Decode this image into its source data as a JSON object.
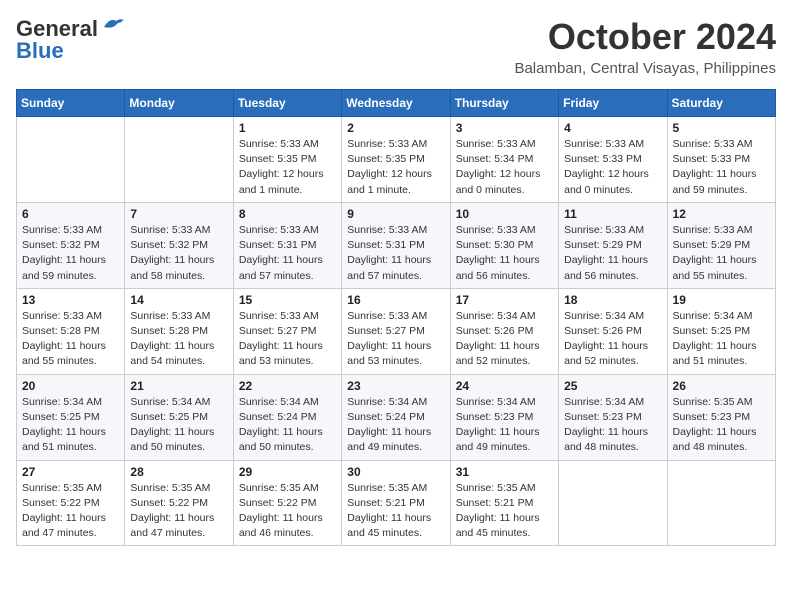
{
  "logo": {
    "line1": "General",
    "line2": "Blue"
  },
  "title": "October 2024",
  "location": "Balamban, Central Visayas, Philippines",
  "header_days": [
    "Sunday",
    "Monday",
    "Tuesday",
    "Wednesday",
    "Thursday",
    "Friday",
    "Saturday"
  ],
  "weeks": [
    [
      {
        "day": "",
        "info": ""
      },
      {
        "day": "",
        "info": ""
      },
      {
        "day": "1",
        "info": "Sunrise: 5:33 AM\nSunset: 5:35 PM\nDaylight: 12 hours\nand 1 minute."
      },
      {
        "day": "2",
        "info": "Sunrise: 5:33 AM\nSunset: 5:35 PM\nDaylight: 12 hours\nand 1 minute."
      },
      {
        "day": "3",
        "info": "Sunrise: 5:33 AM\nSunset: 5:34 PM\nDaylight: 12 hours\nand 0 minutes."
      },
      {
        "day": "4",
        "info": "Sunrise: 5:33 AM\nSunset: 5:33 PM\nDaylight: 12 hours\nand 0 minutes."
      },
      {
        "day": "5",
        "info": "Sunrise: 5:33 AM\nSunset: 5:33 PM\nDaylight: 11 hours\nand 59 minutes."
      }
    ],
    [
      {
        "day": "6",
        "info": "Sunrise: 5:33 AM\nSunset: 5:32 PM\nDaylight: 11 hours\nand 59 minutes."
      },
      {
        "day": "7",
        "info": "Sunrise: 5:33 AM\nSunset: 5:32 PM\nDaylight: 11 hours\nand 58 minutes."
      },
      {
        "day": "8",
        "info": "Sunrise: 5:33 AM\nSunset: 5:31 PM\nDaylight: 11 hours\nand 57 minutes."
      },
      {
        "day": "9",
        "info": "Sunrise: 5:33 AM\nSunset: 5:31 PM\nDaylight: 11 hours\nand 57 minutes."
      },
      {
        "day": "10",
        "info": "Sunrise: 5:33 AM\nSunset: 5:30 PM\nDaylight: 11 hours\nand 56 minutes."
      },
      {
        "day": "11",
        "info": "Sunrise: 5:33 AM\nSunset: 5:29 PM\nDaylight: 11 hours\nand 56 minutes."
      },
      {
        "day": "12",
        "info": "Sunrise: 5:33 AM\nSunset: 5:29 PM\nDaylight: 11 hours\nand 55 minutes."
      }
    ],
    [
      {
        "day": "13",
        "info": "Sunrise: 5:33 AM\nSunset: 5:28 PM\nDaylight: 11 hours\nand 55 minutes."
      },
      {
        "day": "14",
        "info": "Sunrise: 5:33 AM\nSunset: 5:28 PM\nDaylight: 11 hours\nand 54 minutes."
      },
      {
        "day": "15",
        "info": "Sunrise: 5:33 AM\nSunset: 5:27 PM\nDaylight: 11 hours\nand 53 minutes."
      },
      {
        "day": "16",
        "info": "Sunrise: 5:33 AM\nSunset: 5:27 PM\nDaylight: 11 hours\nand 53 minutes."
      },
      {
        "day": "17",
        "info": "Sunrise: 5:34 AM\nSunset: 5:26 PM\nDaylight: 11 hours\nand 52 minutes."
      },
      {
        "day": "18",
        "info": "Sunrise: 5:34 AM\nSunset: 5:26 PM\nDaylight: 11 hours\nand 52 minutes."
      },
      {
        "day": "19",
        "info": "Sunrise: 5:34 AM\nSunset: 5:25 PM\nDaylight: 11 hours\nand 51 minutes."
      }
    ],
    [
      {
        "day": "20",
        "info": "Sunrise: 5:34 AM\nSunset: 5:25 PM\nDaylight: 11 hours\nand 51 minutes."
      },
      {
        "day": "21",
        "info": "Sunrise: 5:34 AM\nSunset: 5:25 PM\nDaylight: 11 hours\nand 50 minutes."
      },
      {
        "day": "22",
        "info": "Sunrise: 5:34 AM\nSunset: 5:24 PM\nDaylight: 11 hours\nand 50 minutes."
      },
      {
        "day": "23",
        "info": "Sunrise: 5:34 AM\nSunset: 5:24 PM\nDaylight: 11 hours\nand 49 minutes."
      },
      {
        "day": "24",
        "info": "Sunrise: 5:34 AM\nSunset: 5:23 PM\nDaylight: 11 hours\nand 49 minutes."
      },
      {
        "day": "25",
        "info": "Sunrise: 5:34 AM\nSunset: 5:23 PM\nDaylight: 11 hours\nand 48 minutes."
      },
      {
        "day": "26",
        "info": "Sunrise: 5:35 AM\nSunset: 5:23 PM\nDaylight: 11 hours\nand 48 minutes."
      }
    ],
    [
      {
        "day": "27",
        "info": "Sunrise: 5:35 AM\nSunset: 5:22 PM\nDaylight: 11 hours\nand 47 minutes."
      },
      {
        "day": "28",
        "info": "Sunrise: 5:35 AM\nSunset: 5:22 PM\nDaylight: 11 hours\nand 47 minutes."
      },
      {
        "day": "29",
        "info": "Sunrise: 5:35 AM\nSunset: 5:22 PM\nDaylight: 11 hours\nand 46 minutes."
      },
      {
        "day": "30",
        "info": "Sunrise: 5:35 AM\nSunset: 5:21 PM\nDaylight: 11 hours\nand 45 minutes."
      },
      {
        "day": "31",
        "info": "Sunrise: 5:35 AM\nSunset: 5:21 PM\nDaylight: 11 hours\nand 45 minutes."
      },
      {
        "day": "",
        "info": ""
      },
      {
        "day": "",
        "info": ""
      }
    ]
  ]
}
